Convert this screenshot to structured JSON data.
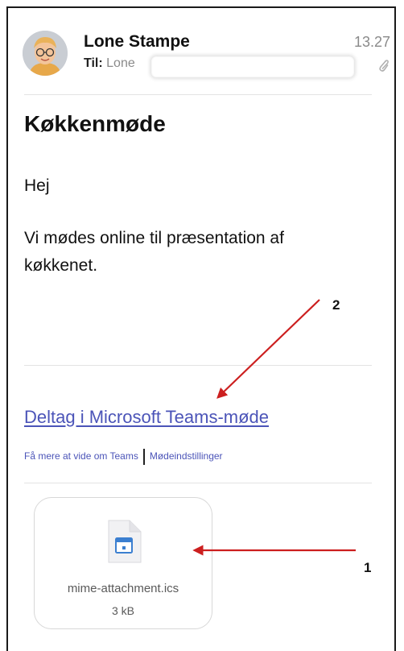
{
  "email": {
    "sender": "Lone Stampe",
    "to_label": "Til:",
    "to_value": "Lone",
    "time": "13.27",
    "subject": "Køkkenmøde",
    "greeting": "Hej",
    "message_line1": "Vi mødes online til præsentation af",
    "message_line2": "køkkenet."
  },
  "teams": {
    "join_link": "Deltag i Microsoft Teams-møde",
    "learn_more": "Få mere at vide om Teams",
    "meeting_options": "Mødeindstillinger"
  },
  "attachment": {
    "filename": "mime-attachment.ics",
    "size": "3 kB",
    "icon": "calendar-file-icon"
  },
  "annotations": {
    "label1": "1",
    "label2": "2",
    "arrow_color": "#cc1f1f"
  },
  "colors": {
    "link": "#4b54b8",
    "muted": "#8a8a8a"
  }
}
